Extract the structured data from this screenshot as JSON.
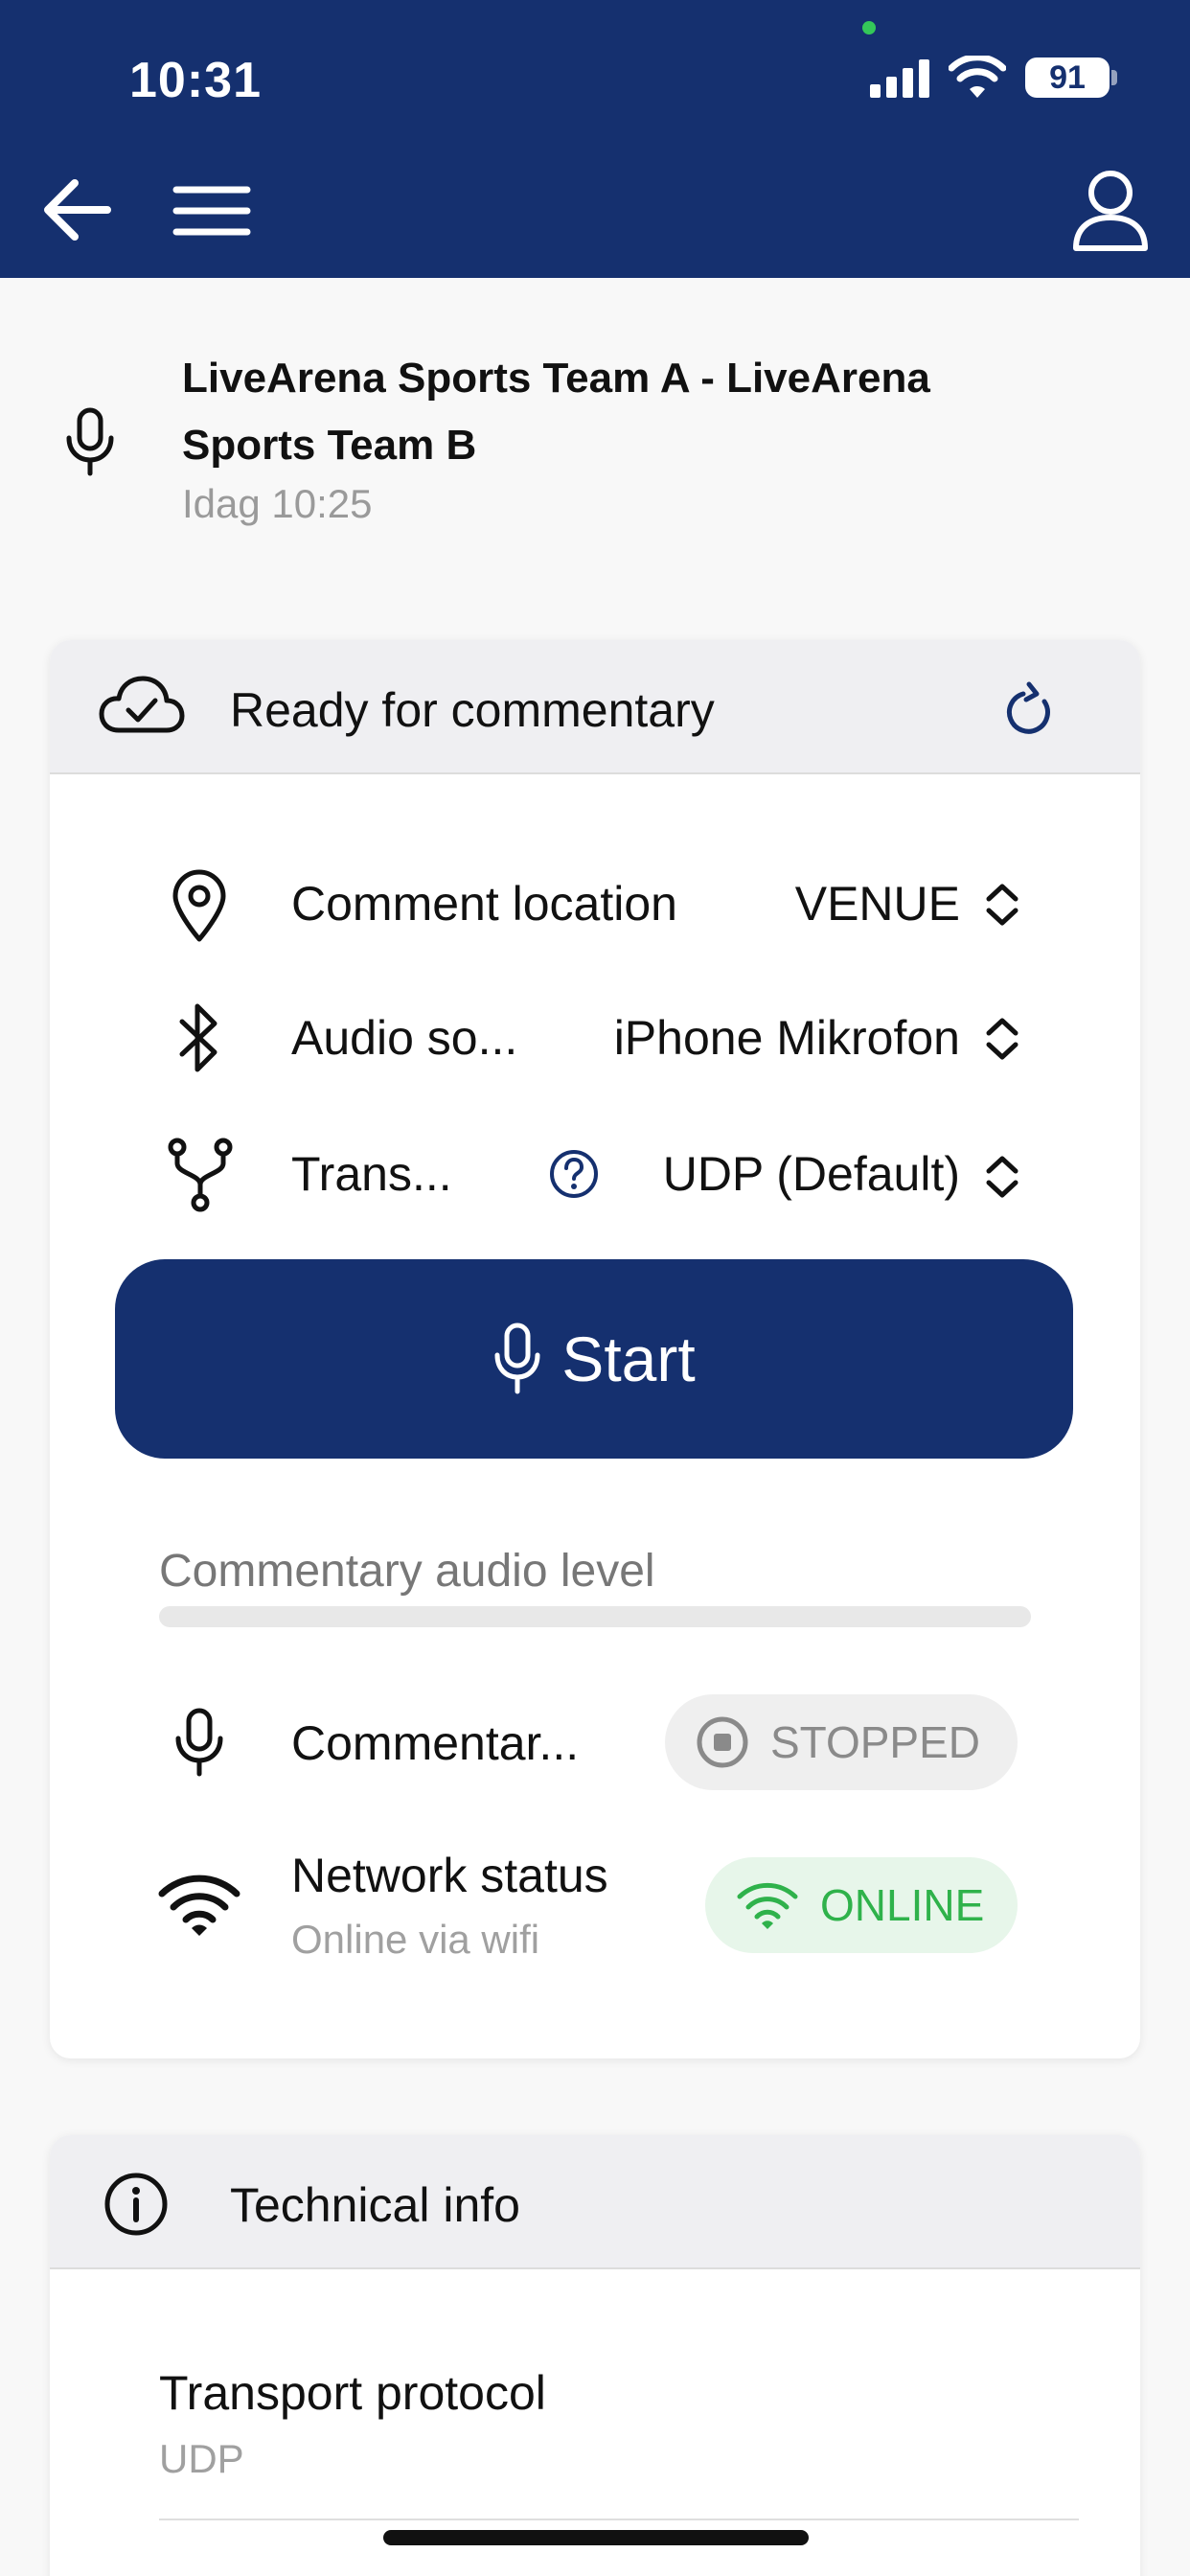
{
  "status_bar": {
    "time": "10:31",
    "battery": "91"
  },
  "event": {
    "title": "LiveArena Sports Team A - LiveArena Sports Team B",
    "time": "Idag 10:25"
  },
  "commentary_card": {
    "status": "Ready for commentary",
    "settings": [
      {
        "label": "Comment location",
        "value": "VENUE",
        "icon": "location-pin-icon"
      },
      {
        "label": "Audio so...",
        "value": "iPhone Mikrofon",
        "icon": "bluetooth-icon"
      },
      {
        "label": "Trans...",
        "value": "UDP (Default)",
        "icon": "fork-icon"
      }
    ],
    "start_label": "Start",
    "audio_level_label": "Commentary audio level",
    "audio_level": 0,
    "commentary_status": {
      "label": "Commentar...",
      "badge": "STOPPED"
    },
    "network_status": {
      "label": "Network status",
      "sub": "Online via wifi",
      "badge": "ONLINE"
    },
    "colors": {
      "brand": "#15306f",
      "online": "#2fb24b",
      "stopped": "#8a8a8a"
    }
  },
  "technical_card": {
    "title": "Technical info",
    "items": [
      {
        "key": "Transport protocol",
        "value": "UDP"
      }
    ]
  }
}
